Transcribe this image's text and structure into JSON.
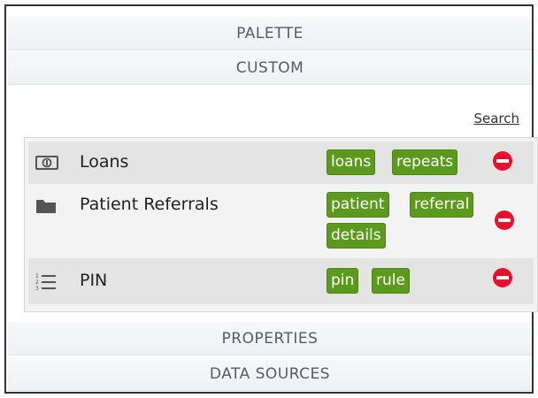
{
  "sections": {
    "palette": "PALETTE",
    "custom": "CUSTOM",
    "properties": "PROPERTIES",
    "data_sources": "DATA SOURCES"
  },
  "search_label": "Search",
  "items": [
    {
      "name": "Loans",
      "icon": "money-icon",
      "tags": [
        "loans",
        "repeats"
      ]
    },
    {
      "name": "Patient Referrals",
      "icon": "folder-icon",
      "tags": [
        "patient",
        "referral",
        "details"
      ]
    },
    {
      "name": "PIN",
      "icon": "numbered-list-icon",
      "tags": [
        "pin",
        "rule"
      ]
    }
  ],
  "colors": {
    "tag_green": "#5b9a1c",
    "remove_red": "#e8112d",
    "header_text": "#555d66"
  }
}
